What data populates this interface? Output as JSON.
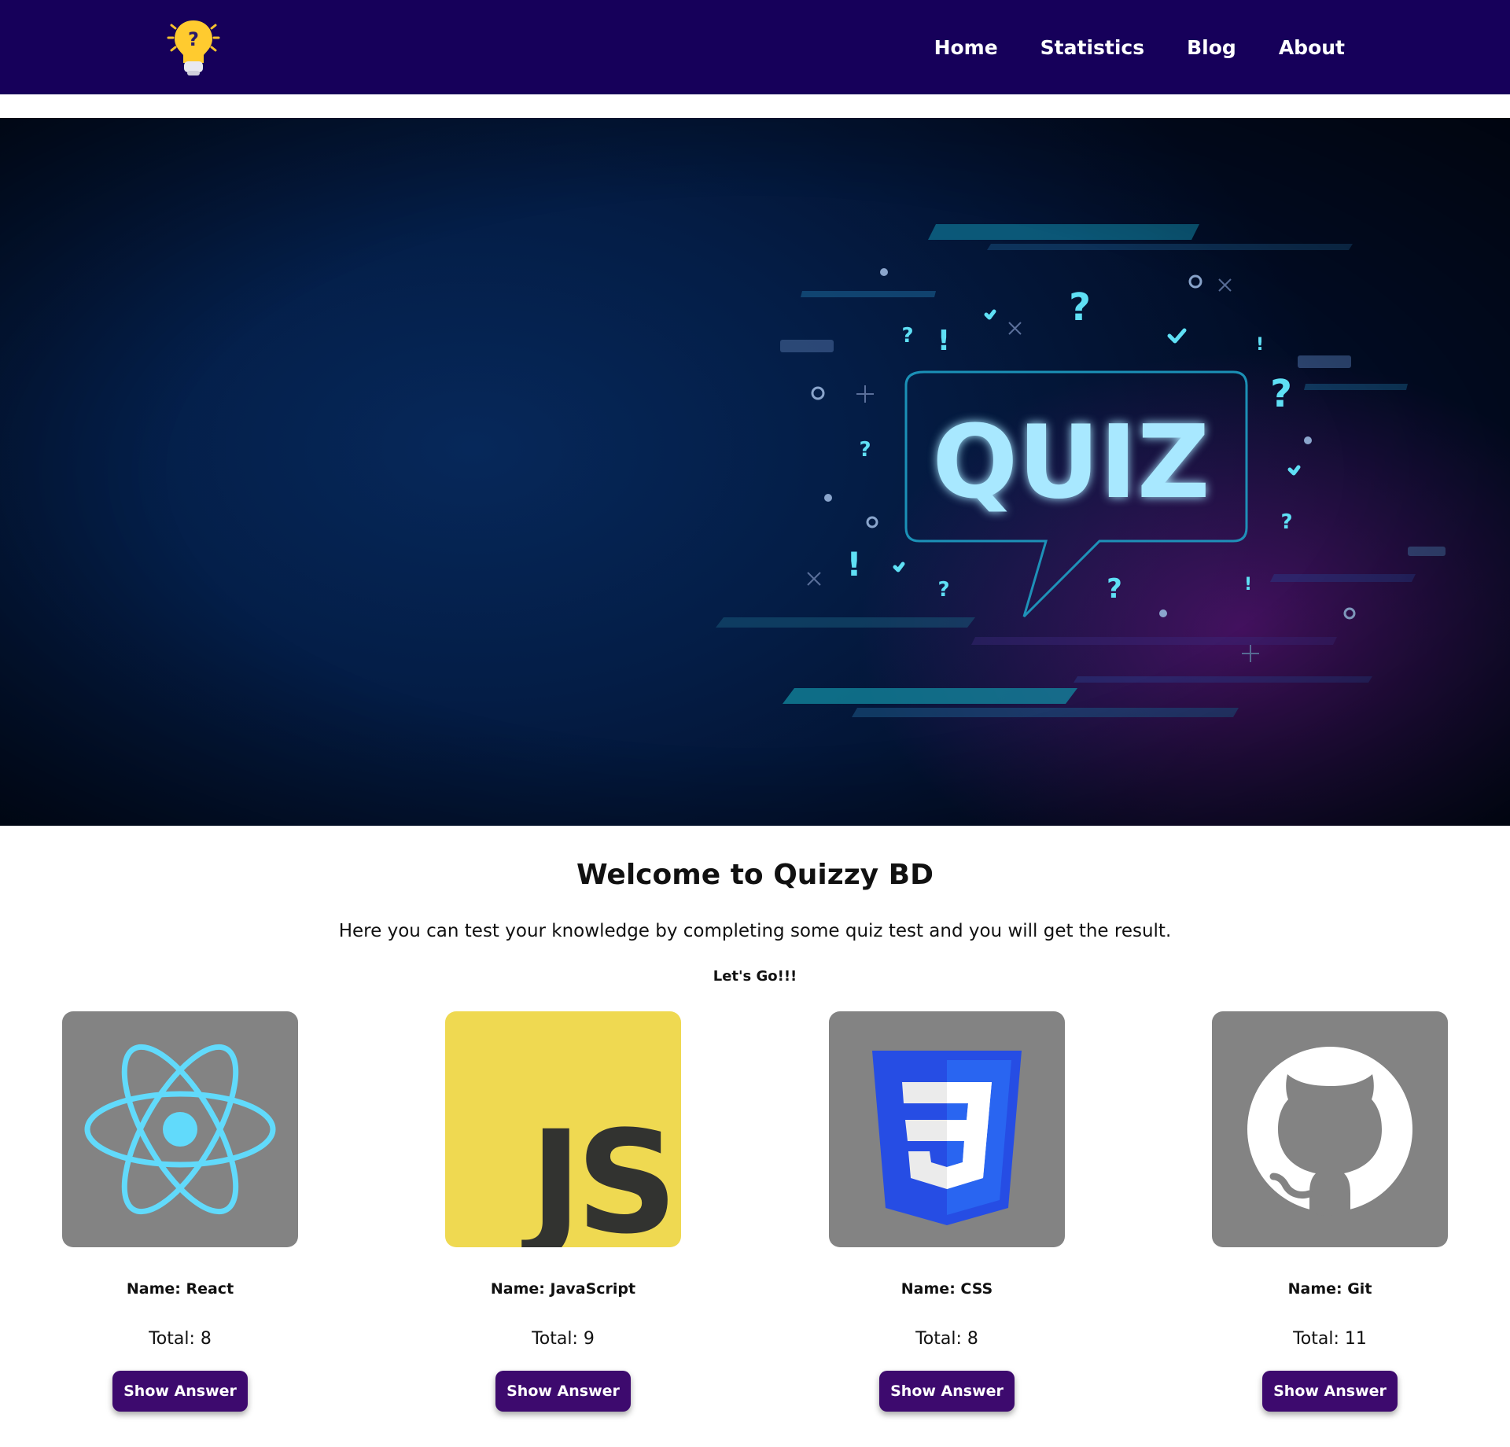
{
  "nav": {
    "items": [
      "Home",
      "Statistics",
      "Blog",
      "About"
    ],
    "bg_color": "#16005a"
  },
  "hero": {
    "banner_text": "QUIZ"
  },
  "welcome": {
    "title": "Welcome to Quizzy BD",
    "subtitle": "Here you can test your knowledge by completing some quiz test and you will get the result.",
    "cta": "Let's Go!!!"
  },
  "quizzes": [
    {
      "name": "Name: React",
      "total": "Total: 8",
      "button": "Show Answer",
      "icon": "react-logo-icon"
    },
    {
      "name": "Name: JavaScript",
      "total": "Total: 9",
      "button": "Show Answer",
      "icon": "javascript-logo-icon"
    },
    {
      "name": "Name: CSS",
      "total": "Total: 8",
      "button": "Show Answer",
      "icon": "css3-logo-icon"
    },
    {
      "name": "Name: Git",
      "total": "Total: 11",
      "button": "Show Answer",
      "icon": "github-logo-icon"
    }
  ],
  "colors": {
    "button": "#3d0a6e",
    "card_bg_gray": "#838383",
    "js_yellow": "#efd951",
    "react_cyan": "#61dafb",
    "css_blue": "#264de4",
    "hero_text": "#a8e8ff"
  }
}
